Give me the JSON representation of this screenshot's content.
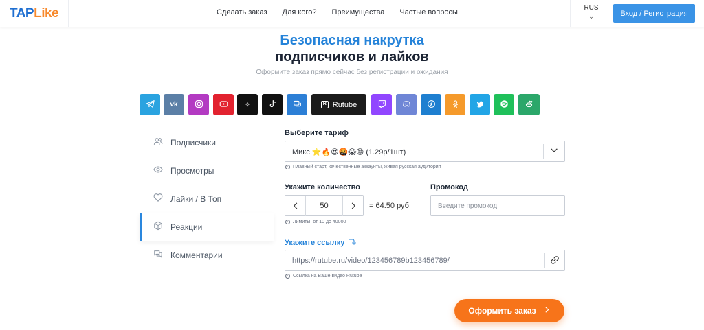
{
  "brand": {
    "part1": "TAP",
    "part2": "Like"
  },
  "nav": [
    {
      "label": "Сделать заказ"
    },
    {
      "label": "Для кого?"
    },
    {
      "label": "Преимущества"
    },
    {
      "label": "Частые вопросы"
    }
  ],
  "lang": {
    "label": "RUS"
  },
  "login": {
    "label": "Вход / Регистрация"
  },
  "hero": {
    "title_line1": "Безопасная накрутка",
    "title_line2": "подписчиков и лайков",
    "subtitle": "Оформите заказ прямо сейчас без регистрации и ожидания"
  },
  "platforms": [
    {
      "icon": "telegram-icon",
      "color": "#2aa3e0"
    },
    {
      "icon": "vk-icon",
      "color": "#5b7fa6"
    },
    {
      "icon": "instagram-icon",
      "color": "#b33ac2"
    },
    {
      "icon": "youtube-icon",
      "color": "#e2222f"
    },
    {
      "icon": "threads-icon",
      "color": "#111111"
    },
    {
      "icon": "tiktok-icon",
      "color": "#111111"
    },
    {
      "icon": "messages-icon",
      "color": "#2c7fd6"
    },
    {
      "icon": "rutube-icon",
      "color": "#1b1b1b",
      "label": "Rutube"
    },
    {
      "icon": "twitch-icon",
      "color": "#9146ff"
    },
    {
      "icon": "discord-icon",
      "color": "#6f86d6"
    },
    {
      "icon": "shazam-icon",
      "color": "#1e7fd0"
    },
    {
      "icon": "odnoklassniki-icon",
      "color": "#f59a2b"
    },
    {
      "icon": "twitter-icon",
      "color": "#22a5e6"
    },
    {
      "icon": "spotify-icon",
      "color": "#1fc05a"
    },
    {
      "icon": "reddit-icon",
      "color": "#2ba76a"
    }
  ],
  "sidebar": [
    {
      "label": "Подписчики",
      "icon": "users-icon"
    },
    {
      "label": "Просмотры",
      "icon": "eye-icon"
    },
    {
      "label": "Лайки / В Топ",
      "icon": "heart-icon"
    },
    {
      "label": "Реакции",
      "icon": "box-icon",
      "active": true
    },
    {
      "label": "Комментарии",
      "icon": "comments-icon"
    }
  ],
  "form": {
    "tariff_label": "Выберите тариф",
    "tariff_value": "Микс ⭐🔥😍🤬😱😡 (1.29р/1шт)",
    "tariff_hint": "Плавный старт, качественные аккаунты, живая русская аудитория",
    "qty_label": "Укажите количество",
    "qty_value": "50",
    "qty_total": "= 64.50 руб",
    "qty_hint": "Лимиты: от 10 до 40000",
    "promo_label": "Промокод",
    "promo_placeholder": "Введите промокод",
    "link_label": "Укажите ссылку",
    "link_value": "https://rutube.ru/video/123456789b123456789/",
    "link_hint": "Ссылка на Ваше видео Rutube"
  },
  "submit": {
    "label": "Оформить заказ"
  }
}
